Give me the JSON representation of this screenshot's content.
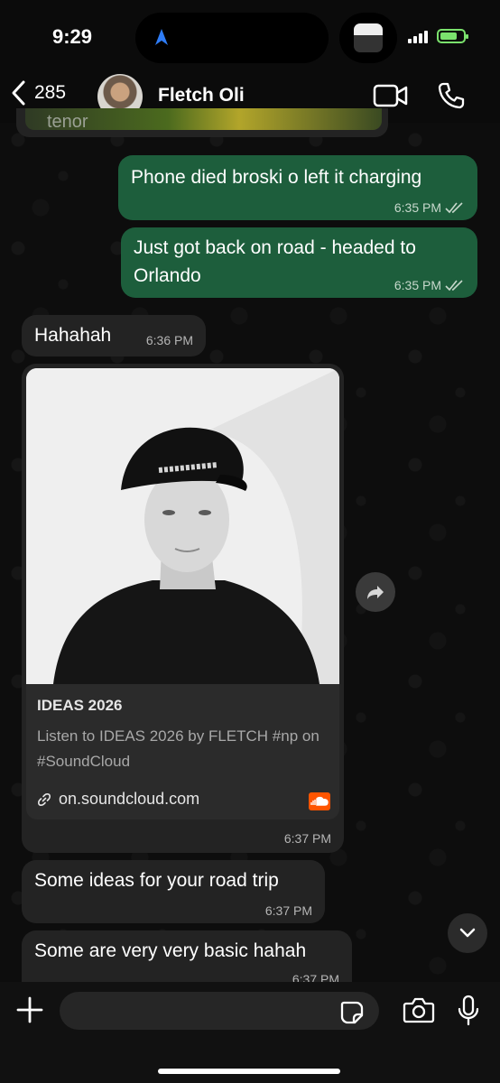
{
  "status_bar": {
    "time": "9:29"
  },
  "header": {
    "back_count": "285",
    "contact_name": "Fletch Oli"
  },
  "messages": [
    {
      "direction": "out",
      "text": "Phone died broski o left it charging",
      "time": "6:35 PM",
      "status": "read"
    },
    {
      "direction": "out",
      "text": "Just got back on road - headed to Orlando",
      "time": "6:35 PM",
      "status": "read"
    },
    {
      "direction": "in",
      "text": "Hahahah",
      "time": "6:36 PM"
    },
    {
      "direction": "in",
      "type": "link",
      "time": "6:37 PM"
    },
    {
      "direction": "in",
      "text": "Some ideas for your road trip",
      "time": "6:37 PM"
    },
    {
      "direction": "in",
      "text": "Some are very very basic hahah",
      "time": "6:37 PM"
    }
  ],
  "gif_preview": {
    "label": "tenor"
  },
  "link_preview": {
    "title": "IDEAS 2026",
    "description": "Listen to IDEAS 2026 by FLETCH #np on #SoundCloud",
    "domain": "on.soundcloud.com",
    "hat_text": "FLETCH"
  },
  "colors": {
    "outgoing_bubble": "#1d5e3c",
    "incoming_bubble": "#232323",
    "battery": "#7be26d",
    "soundcloud": "#ff5500",
    "location_arrow": "#2e7cf6"
  },
  "input": {
    "placeholder": ""
  }
}
